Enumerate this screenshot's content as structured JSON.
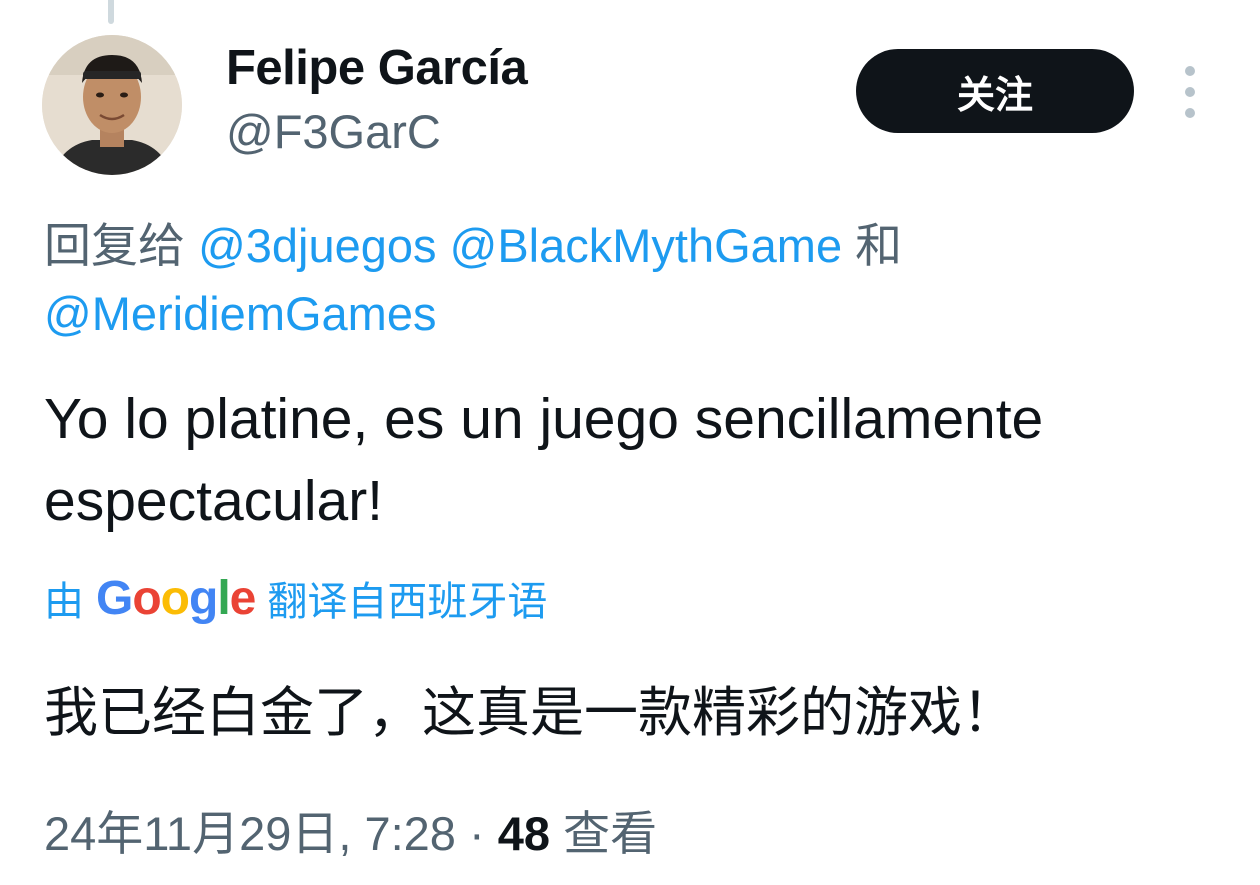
{
  "user": {
    "display_name": "Felipe García",
    "handle": "@F3GarC",
    "avatar_icon": "profile-photo"
  },
  "follow_button_label": "关注",
  "more_icon": "vertical-ellipsis-icon",
  "reply": {
    "prefix": "回复给",
    "mentions": [
      "@3djuegos",
      "@BlackMythGame",
      "@MeridiemGames"
    ],
    "joiner": "和"
  },
  "tweet_text": "Yo lo platine, es un juego sencillamente espectacular!",
  "translation": {
    "prefix": "由",
    "google_letters": [
      "G",
      "o",
      "o",
      "g",
      "l",
      "e"
    ],
    "suffix": "翻译自西班牙语",
    "translated_text": "我已经白金了，这真是一款精彩的游戏！"
  },
  "meta": {
    "timestamp": "24年11月29日, 7:28",
    "separator": "·",
    "views_count": "48",
    "views_label": "查看"
  },
  "colors": {
    "link": "#1d9bf0",
    "secondary_text": "#536471",
    "primary_text": "#0f1419",
    "button_bg": "#0f1419"
  }
}
